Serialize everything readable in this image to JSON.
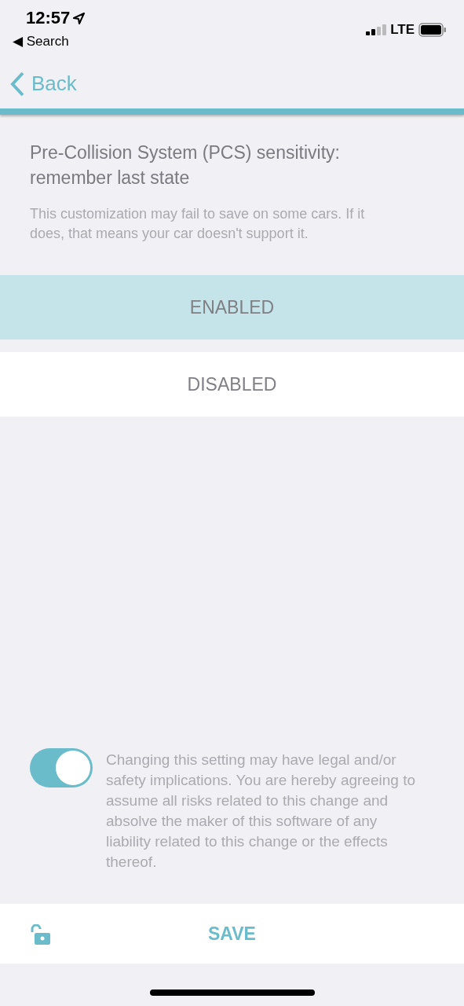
{
  "status_bar": {
    "time": "12:57",
    "back_app": "◀ Search",
    "network": "LTE"
  },
  "nav": {
    "back": "Back"
  },
  "setting": {
    "title": "Pre-Collision System (PCS) sensitivity: remember last state",
    "description": "This customization may fail to save on some cars. If it does, that means your car doesn't support it."
  },
  "options": [
    {
      "label": "ENABLED",
      "selected": true
    },
    {
      "label": "DISABLED",
      "selected": false
    }
  ],
  "consent": {
    "on": true,
    "text": "Changing this setting may have legal and/or safety implications. You are hereby agreeing to assume all risks related to this change and absolve the maker of this software of any liability related to this change or the effects thereof."
  },
  "footer": {
    "save": "SAVE"
  }
}
